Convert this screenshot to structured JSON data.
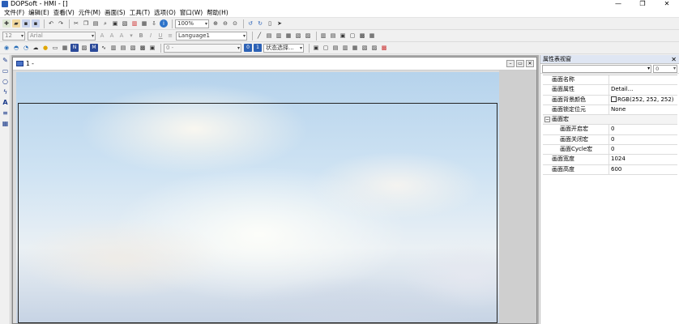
{
  "window": {
    "title": "DOPSoft - HMI - []",
    "min": "—",
    "max": "❐",
    "close": "✕"
  },
  "menu": [
    "文件(F)",
    "编辑(E)",
    "查看(V)",
    "元件(M)",
    "画面(S)",
    "工具(T)",
    "选项(O)",
    "窗口(W)",
    "帮助(H)"
  ],
  "toolbar1": {
    "zoom": "100%"
  },
  "toolbar2": {
    "font_size": "12",
    "font_name": "Arial",
    "language": "Language1"
  },
  "toolbar3": {
    "value_field": "0 -",
    "state_select": "状态选择..."
  },
  "document": {
    "label": "1 -",
    "min": "–",
    "restore": "▭",
    "close": "✕"
  },
  "properties": {
    "title": "属性表视窗",
    "close": "✕",
    "combo_value": "0",
    "rows": [
      {
        "name": "画面名称",
        "value": ""
      },
      {
        "name": "画面属性",
        "value": "Detail..."
      },
      {
        "name": "画面背景颜色",
        "value": "RGB(252, 252, 252)",
        "swatch": "#fcfcfc"
      },
      {
        "name": "画面锁定位元",
        "value": "None"
      }
    ],
    "group": {
      "name": "画面宏",
      "expander": "−"
    },
    "sub_rows": [
      {
        "name": "画面开启宏",
        "value": "0"
      },
      {
        "name": "画面关闭宏",
        "value": "0"
      },
      {
        "name": "画面Cycle宏",
        "value": "0"
      }
    ],
    "size_rows": [
      {
        "name": "画面宽度",
        "value": "1024"
      },
      {
        "name": "画面高度",
        "value": "600"
      }
    ]
  }
}
